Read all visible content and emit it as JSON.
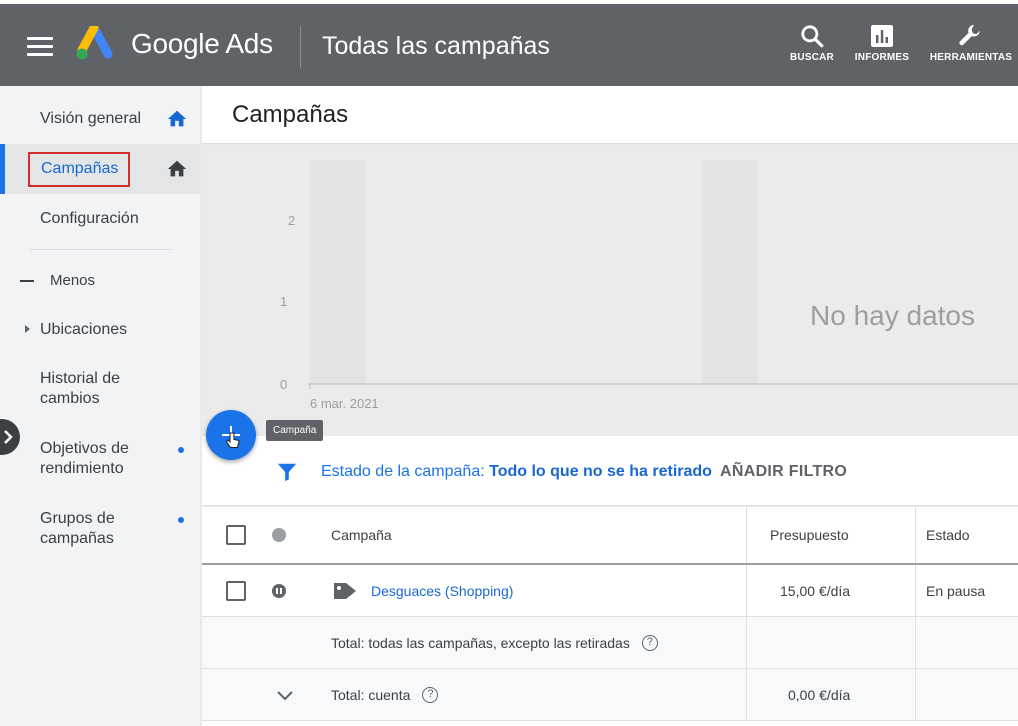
{
  "header": {
    "brand": "Google Ads",
    "page_name": "Todas las campañas",
    "buttons": {
      "search": "BUSCAR",
      "reports": "INFORMES",
      "tools": "HERRAMIENTAS"
    }
  },
  "sidebar": {
    "overview": "Visión general",
    "campaigns": "Campañas",
    "settings": "Configuración",
    "less": "Menos",
    "locations": "Ubicaciones",
    "history": [
      "Historial de",
      "cambios"
    ],
    "goals": [
      "Objetivos de",
      "rendimiento"
    ],
    "groups": [
      "Grupos de",
      "campañas"
    ]
  },
  "main": {
    "title": "Campañas",
    "chart": {
      "y_ticks": [
        "2",
        "1",
        "0"
      ],
      "x_label": "6 mar. 2021",
      "empty_message": "No hay datos"
    },
    "fab_tooltip": "Campaña",
    "filter": {
      "label": "Estado de la campaña:",
      "value": "Todo lo que no se ha retirado",
      "add": "AÑADIR FILTRO"
    },
    "table": {
      "headers": {
        "campaign": "Campaña",
        "budget": "Presupuesto",
        "status": "Estado"
      },
      "rows": [
        {
          "name": "Desguaces (Shopping)",
          "budget": "15,00 €/día",
          "status": "En pausa"
        }
      ],
      "total_all": "Total: todas las campañas, excepto las retiradas",
      "total_account": "Total: cuenta",
      "total_account_budget": "0,00 €/día"
    }
  },
  "colors": {
    "header_bg": "#5f6368",
    "accent": "#1a73e8",
    "highlight_border": "#d32f2f"
  }
}
